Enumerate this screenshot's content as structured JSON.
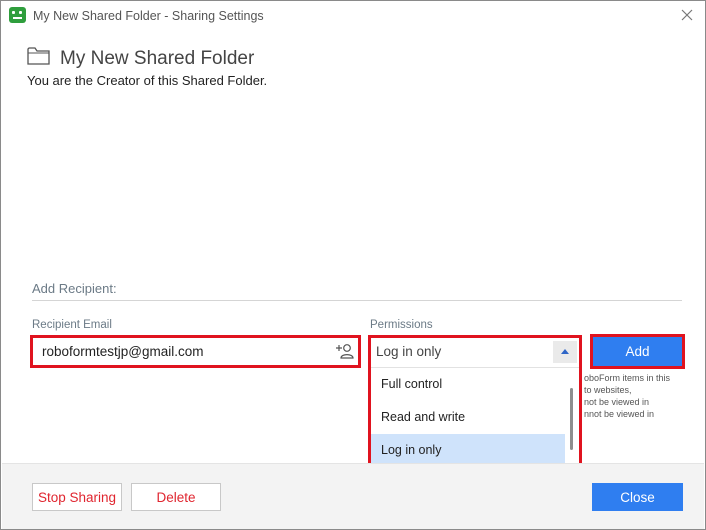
{
  "window": {
    "title": "My New Shared Folder - Sharing Settings",
    "app_icon": "roboform-icon",
    "close_icon": "close-icon"
  },
  "folder": {
    "icon": "folder-icon",
    "name": "My New Shared Folder",
    "creator_note": "You are the Creator of this Shared Folder."
  },
  "add_recipient": {
    "section_label": "Add Recipient:",
    "email_label": "Recipient Email",
    "email_value": "roboformtestjp@gmail.com",
    "email_icon": "add-person-icon",
    "permissions_label": "Permissions",
    "permissions_selected": "Log in only",
    "permissions_options": [
      "Full control",
      "Read and write",
      "Log in only"
    ],
    "add_label": "Add",
    "partial_help_lines": [
      "oboForm items in this",
      "to websites,",
      "not be viewed in",
      "nnot be viewed in"
    ]
  },
  "footer": {
    "stop_sharing_label": "Stop Sharing",
    "delete_label": "Delete",
    "close_label": "Close"
  },
  "colors": {
    "accent": "#2f7ef0",
    "highlight_border": "#e0131f",
    "danger_text": "#e0252f",
    "selected_option": "#cfe3fb"
  }
}
